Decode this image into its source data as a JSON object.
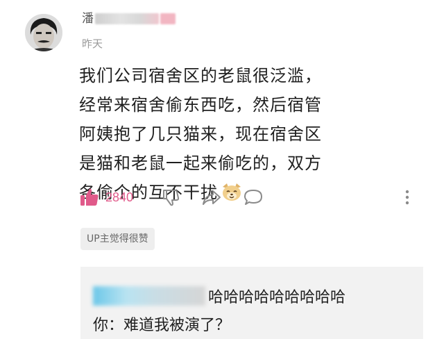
{
  "comment": {
    "username_char": "潘",
    "timestamp": "昨天",
    "body": "我们公司宿舍区的老鼠很泛滥，经常来宿舍偷东西吃，然后宿管阿姨抱了几只猫来，现在宿舍区是猫和老鼠一起来偷吃的，双方各偷个的互不干扰",
    "emoji_icon": "dog-face-icon",
    "like_count": "2840",
    "badge": "UP主觉得很赞"
  },
  "reply": {
    "text": "哈哈哈哈哈哈哈哈哈",
    "second_line": "你：难道我被演了？"
  },
  "colors": {
    "like_pink": "#e05a8a",
    "icon_gray": "#8a8a8a",
    "reply_bg": "#f2f2f2",
    "badge_bg": "#eeeeee"
  }
}
